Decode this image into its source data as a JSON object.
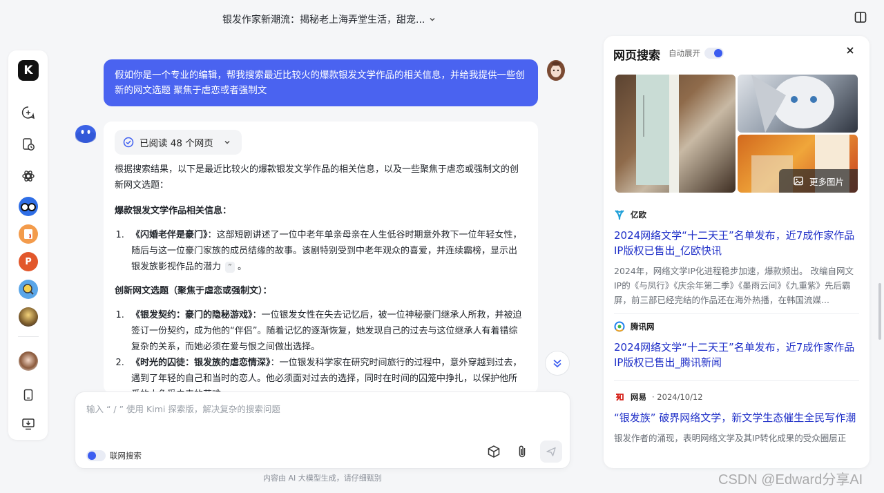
{
  "header": {
    "conversation_title": "银发作家新潮流：揭秘老上海弄堂生活，甜宠...",
    "chevron_icon": "chevron-down-icon",
    "layout_toggle_icon": "sidebar-toggle-icon"
  },
  "sidebar": {
    "logo_text": "K",
    "items": [
      {
        "icon": "new-chat-icon"
      },
      {
        "icon": "history-icon"
      },
      {
        "icon": "explore-icon"
      },
      {
        "icon": "app-glasses-icon"
      },
      {
        "icon": "app-orange-icon"
      },
      {
        "icon": "app-ppt-icon"
      },
      {
        "icon": "app-search-icon"
      },
      {
        "icon": "app-avatar-icon"
      },
      {
        "icon": "user-avatar-icon"
      },
      {
        "icon": "mobile-icon"
      },
      {
        "icon": "download-app-icon"
      }
    ]
  },
  "chat": {
    "user_message": "假如你是一个专业的编辑，帮我搜索最近比较火的爆款银发文学作品的相关信息，并给我提供一些创新的网文选题 聚焦于虐恋或者强制文",
    "read_status": "已阅读 48 个网页",
    "answer": {
      "intro": "根据搜索结果，以下是最近比较火的爆款银发文学作品的相关信息，以及一些聚焦于虐恋或强制文的创新网文选题：",
      "section1_heading": "爆款银发文学作品相关信息：",
      "section1_items": [
        {
          "title": "《闪婚老伴是豪门》",
          "text": "：这部短剧讲述了一位中老年单亲母亲在人生低谷时期意外救下一位年轻女性，随后与这一位豪门家族的成员结缘的故事。该剧特别受到中老年观众的喜爱，并连续霸榜，显示出银发族影视作品的潜力",
          "quote": "”",
          "end": "。"
        }
      ],
      "section2_heading": "创新网文选题（聚焦于虐恋或强制文）：",
      "section2_items": [
        {
          "title": "《银发契约：豪门的隐秘游戏》",
          "text": "：一位银发女性在失去记忆后，被一位神秘豪门继承人所救，并被迫签订一份契约，成为他的“伴侣”。随着记忆的逐渐恢复，她发现自己的过去与这位继承人有着错综复杂的关系，而她必须在爱与恨之间做出选择。"
        },
        {
          "title": "《时光的囚徒：银发族的虐恋情深》",
          "text": "：一位银发科学家在研究时间旅行的过程中，意外穿越到过去，遇到了年轻的自己和当时的恋人。他必须面对过去的选择，同时在时间的囚笼中挣扎，以保护他所爱的人免受未来的苦难。"
        }
      ]
    }
  },
  "input": {
    "placeholder": "输入 “ / ” 使用 Kimi 探索版，解决复杂的搜索问题",
    "web_search_label": "联网搜索",
    "web_search_on": true
  },
  "footer_note": "内容由 AI 大模型生成，请仔细甄别",
  "right_panel": {
    "title": "网页搜索",
    "auto_expand_label": "自动展开",
    "auto_expand_on": true,
    "more_images_label": "更多图片",
    "results": [
      {
        "source": "亿欧",
        "source_icon": "yiou-logo-icon",
        "date": "",
        "title": "2024网络文学“十二天王”名单发布，近7成作家作品IP版权已售出_亿欧快讯",
        "snippet": "2024年，网络文学IP化进程稳步加速，爆款频出。 改编自网文IP的《与凤行》《庆余年第二季》《墨雨云间》《九重紫》先后霸屏，前三部已经完结的作品还在海外热播，在韩国流媒..."
      },
      {
        "source": "腾讯网",
        "source_icon": "tencent-logo-icon",
        "date": "",
        "title": "2024网络文学“十二天王”名单发布，近7成作家作品IP版权已售出_腾讯新闻",
        "snippet": ""
      },
      {
        "source": "网易",
        "source_icon": "netease-logo-icon",
        "date": "· 2024/10/12",
        "title": "“银发族” 破界网络文学，新文学生态催生全民写作潮",
        "snippet": "银发作者的涌现，表明网络文学及其IP转化成果的受众圈层正"
      }
    ]
  },
  "watermark": "CSDN @Edward分享AI",
  "colors": {
    "accent": "#4a63f0",
    "link": "#2030c8",
    "toggle_knob": "#3b5cf0"
  }
}
